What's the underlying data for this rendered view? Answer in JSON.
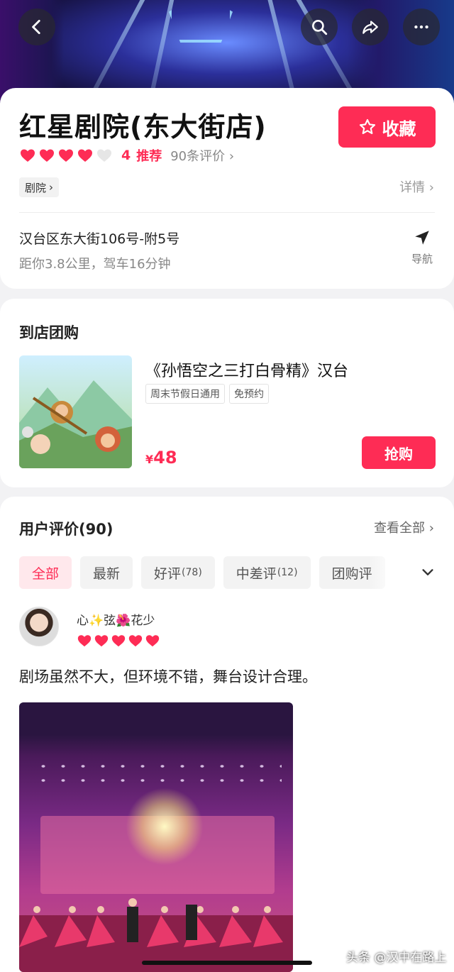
{
  "header": {
    "back_icon": "chevron-left-icon",
    "search_icon": "search-icon",
    "share_icon": "share-icon",
    "more_icon": "more-icon"
  },
  "shop": {
    "name": "红星剧院(东大街店)",
    "favorite_label": "收藏",
    "rating": 4,
    "rating_max": 5,
    "rating_score": "4",
    "rating_label": "推荐",
    "review_count": "90条评价",
    "category": "剧院",
    "details_label": "详情",
    "address": "汉台区东大街106号-附5号",
    "distance": "距你3.8公里，驾车16分钟",
    "nav_label": "导航"
  },
  "deal": {
    "section_title": "到店团购",
    "title": "《孙悟空之三打白骨精》汉台",
    "tags": [
      "周末节假日通用",
      "免预约"
    ],
    "price_currency": "¥",
    "price": "48",
    "buy_label": "抢购"
  },
  "reviews": {
    "section_title": "用户评价(90)",
    "view_all": "查看全部",
    "filters": [
      {
        "label": "全部",
        "count": ""
      },
      {
        "label": "最新",
        "count": ""
      },
      {
        "label": "好评",
        "count": "(78)"
      },
      {
        "label": "中差评",
        "count": "(12)"
      },
      {
        "label": "团购评",
        "count": ""
      }
    ],
    "items": [
      {
        "user": "心✨弦🌺花少",
        "rating": 5,
        "text": "剧场虽然不大，但环境不错，舞台设计合理。"
      }
    ]
  },
  "watermark": "头条 @汉中在路上",
  "colors": {
    "accent": "#fe2c55",
    "heart_inactive": "#e6e6e6"
  }
}
